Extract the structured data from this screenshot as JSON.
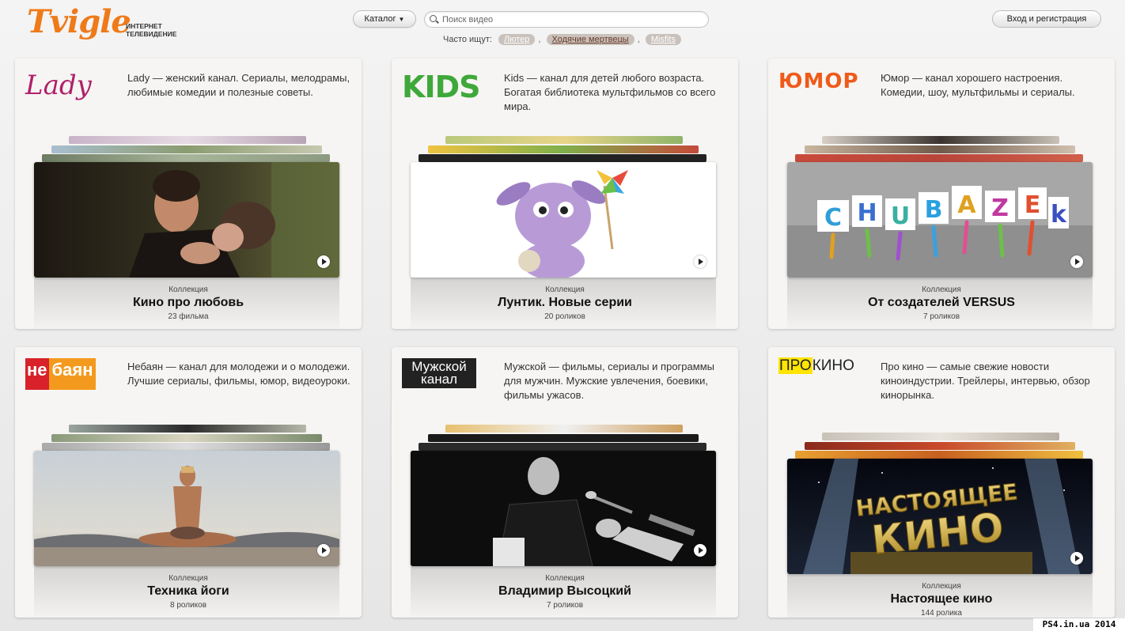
{
  "header": {
    "logo_word": "Tvigle",
    "logo_tagline": "Интернет телевидение",
    "catalog_label": "Каталог",
    "search_placeholder": "Поиск видео",
    "popular_label": "Часто ищут:",
    "popular_tags": [
      "Лютер",
      "Ходячие мертвецы",
      "Misfits"
    ],
    "login_label": "Вход и регистрация"
  },
  "cards": [
    {
      "logo": "Lady",
      "description": "Lady — женский канал. Сериалы, мелодрамы, любимые комедии и полезные советы.",
      "collection_label": "Коллекция",
      "title": "Кино про любовь",
      "count": "23 фильма",
      "thumb_desc": "romantic-film-still"
    },
    {
      "logo": "KIDS",
      "description": "Kids — канал для детей любого возраста. Богатая библиотека мультфильмов со всего мира.",
      "collection_label": "Коллекция",
      "title": "Лунтик. Новые серии",
      "count": "20 роликов",
      "thumb_desc": "luntik-cartoon"
    },
    {
      "logo": "ЮМОР",
      "description": "Юмор — канал хорошего настроения. Комедии, шоу, мультфильмы и сериалы.",
      "collection_label": "Коллекция",
      "title": "От создателей VERSUS",
      "count": "7 роликов",
      "thumb_desc": "chubazeki-letters",
      "thumb_text": "CHUBAZEKi"
    },
    {
      "logo_a": "не",
      "logo_b": "баян",
      "description": "Небаян — канал для молодежи и о молодежи. Лучшие сериалы, фильмы, юмор, видеоуроки.",
      "collection_label": "Коллекция",
      "title": "Техника йоги",
      "count": "8 роликов",
      "thumb_desc": "yoga-sunset"
    },
    {
      "logo": "Мужской канал",
      "description": "Мужской — фильмы, сериалы и программы для мужчин. Мужские увлечения, боевики, фильмы ужасов.",
      "collection_label": "Коллекция",
      "title": "Владимир Высоцкий",
      "count": "7 роликов",
      "thumb_desc": "singer-with-guitar"
    },
    {
      "logo_a": "ПРО",
      "logo_b": "КИНО",
      "description": "Про кино — самые свежие новости киноиндустрии. Трейлеры, интервью, обзор кинорынка.",
      "collection_label": "Коллекция",
      "title": "Настоящее кино",
      "count": "144 ролика",
      "thumb_desc": "gold-letters-spotlights",
      "thumb_text": "НАСТОЯЩЕЕ КИНО"
    }
  ],
  "watermark": "PS4.in.ua  2014"
}
